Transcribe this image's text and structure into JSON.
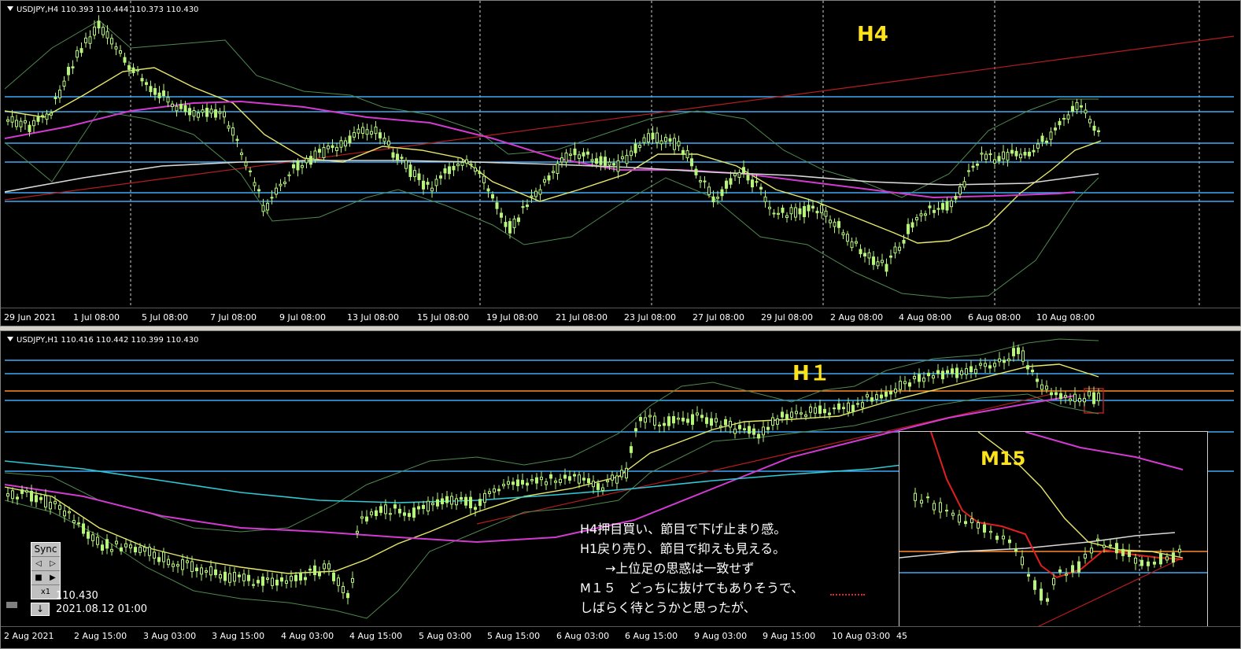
{
  "top": {
    "header": "USDJPY,H4  110.393 110.444 110.373 110.430",
    "timeframe_label": "H4",
    "x_labels": [
      "29 Jun 2021",
      "1 Jul 08:00",
      "5 Jul 08:00",
      "7 Jul 08:00",
      "9 Jul 08:00",
      "13 Jul 08:00",
      "15 Jul 08:00",
      "19 Jul 08:00",
      "21 Jul 08:00",
      "23 Jul 08:00",
      "27 Jul 08:00",
      "29 Jul 08:00",
      "2 Aug 08:00",
      "4 Aug 08:00",
      "6 Aug 08:00",
      "10 Aug 08:00"
    ]
  },
  "bottom": {
    "header": "USDJPY,H1  110.416 110.442 110.399 110.430",
    "timeframe_label": "H１",
    "x_labels": [
      "2 Aug 2021",
      "2 Aug 15:00",
      "3 Aug 03:00",
      "3 Aug 15:00",
      "4 Aug 03:00",
      "4 Aug 15:00",
      "5 Aug 03:00",
      "5 Aug 15:00",
      "6 Aug 03:00",
      "6 Aug 15:00",
      "9 Aug 03:00",
      "9 Aug 15:00",
      "10 Aug 03:00"
    ],
    "cut_label": "45",
    "inset_label": "M15",
    "note_lines": [
      "H4押目買い、節目で下げ止まり感。",
      "H1戻り売り、節目で抑えも見える。",
      "　　→上位足の思惑は一致せず",
      "M１５　どっちに抜けてもありそうで、",
      "しばらく待とうかと思ったが、"
    ],
    "controls": {
      "sync_label": "Sync",
      "prev_icon": "◁",
      "next_icon": "▷",
      "stop_icon": "■",
      "play_icon": "▶",
      "speed_label": "x1",
      "down_icon": "↓"
    },
    "price": "110.430",
    "datetime": "2021.08.12 01:00"
  },
  "colors": {
    "background": "#000000",
    "candle": "#b6f57a",
    "level_line": "#3fa9f5",
    "trend_line": "#b81d1d",
    "ma_fast": "#e8e86a",
    "ma_mid": "#d23ad2",
    "ma_slow": "#d8d8d8",
    "band": "#4e8a4e",
    "label_yellow": "#ffe31a",
    "orange_line": "#ff8c28"
  }
}
